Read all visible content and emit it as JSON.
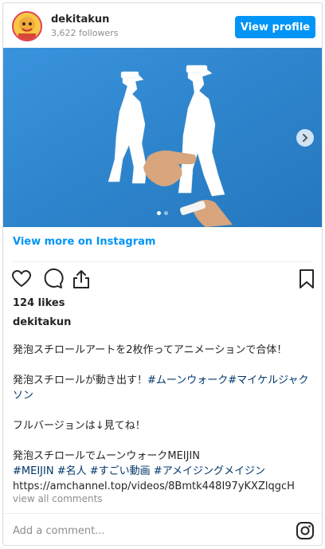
{
  "header": {
    "username": "dekitakun",
    "followers": "3,622 followers",
    "view_profile_label": "View profile"
  },
  "post": {
    "view_more_label": "View more on Instagram",
    "likes": "124 likes",
    "caption_user": "dekitakun",
    "caption_lines": {
      "line1": "発泡スチロールアートを2枚作ってアニメーションで合体！",
      "line2_prefix": "発泡スチロールが動き出す！",
      "line2_tag1": "#ムーンウォーク",
      "line2_tag2": "#マイケルジャクソン",
      "line3": "フルバージョンは↓見てね！",
      "line4": "発泡スチロールでムーンウォークMEIJIN",
      "tag_meijin": "#MEIJIN",
      "tag_meijin2": "#名人",
      "tag_sugoi": "#すごい動画",
      "tag_amazing": "#アメイジングメイジン",
      "url": "https://amchannel.top/videos/8Bmtk448I97yKXZlqgcH"
    },
    "view_comments_label": "view all comments",
    "comment_placeholder": "Add a comment...",
    "carousel": {
      "slide_count": 2,
      "active_index": 0
    }
  },
  "colors": {
    "accent": "#0095f6",
    "media_background": "#2f86cf",
    "hashtag": "#00376b",
    "muted": "#8e8e8e"
  },
  "icons": [
    "heart-icon",
    "comment-icon",
    "share-icon",
    "bookmark-icon",
    "chevron-right-icon",
    "instagram-icon"
  ]
}
